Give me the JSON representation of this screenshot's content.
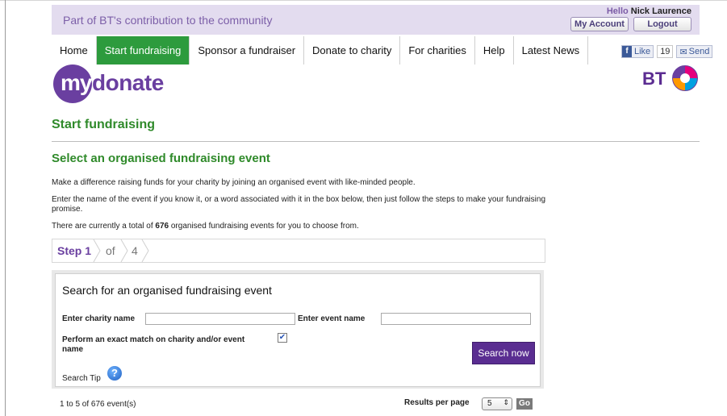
{
  "topbar": {
    "tagline": "Part of BT's contribution to the community",
    "hello_prefix": "Hello",
    "user_name": "Nick Laurence",
    "my_account_label": "My Account",
    "logout_label": "Logout"
  },
  "nav": {
    "items": [
      {
        "label": "Home"
      },
      {
        "label": "Start fundraising",
        "active": true
      },
      {
        "label": "Sponsor a fundraiser"
      },
      {
        "label": "Donate to charity"
      },
      {
        "label": "For charities"
      },
      {
        "label": "Help"
      },
      {
        "label": "Latest News"
      }
    ]
  },
  "social": {
    "like_label": "Like",
    "like_count": "19",
    "send_label": "Send"
  },
  "brand": {
    "logo_my": "my",
    "logo_donate": "donate",
    "partner": "BT"
  },
  "page": {
    "title": "Start fundraising",
    "section_title": "Select an organised fundraising event",
    "intro": "Make a difference raising funds for your charity by joining an organised event with like-minded people.",
    "instructions": "Enter the name of the event if you know it, or a word associated with it in the box below, then just follow the steps to make your fundraising promise.",
    "total_prefix": "There are currently a total of",
    "total_count": "676",
    "total_suffix": "organised fundraising events for you to choose from."
  },
  "steps": {
    "current": "Step 1",
    "of": "of",
    "total": "4"
  },
  "search_panel": {
    "title": "Search for an organised fundraising event",
    "charity_label": "Enter charity name",
    "charity_value": "",
    "event_label": "Enter event name",
    "event_value": "",
    "exact_match_label": "Perform an exact match on charity and/or event name",
    "exact_match_checked": true,
    "search_button": "Search now",
    "tip_label": "Search Tip"
  },
  "results": {
    "summary": "1 to 5 of 676 event(s)",
    "per_page_label": "Results per page",
    "per_page_value": "5",
    "go_label": "Go"
  },
  "colors": {
    "brand_purple": "#6a3fa0",
    "nav_active_green": "#2d9b3d",
    "heading_green": "#2f8a2a",
    "topbar_lilac": "#e3dcef"
  }
}
